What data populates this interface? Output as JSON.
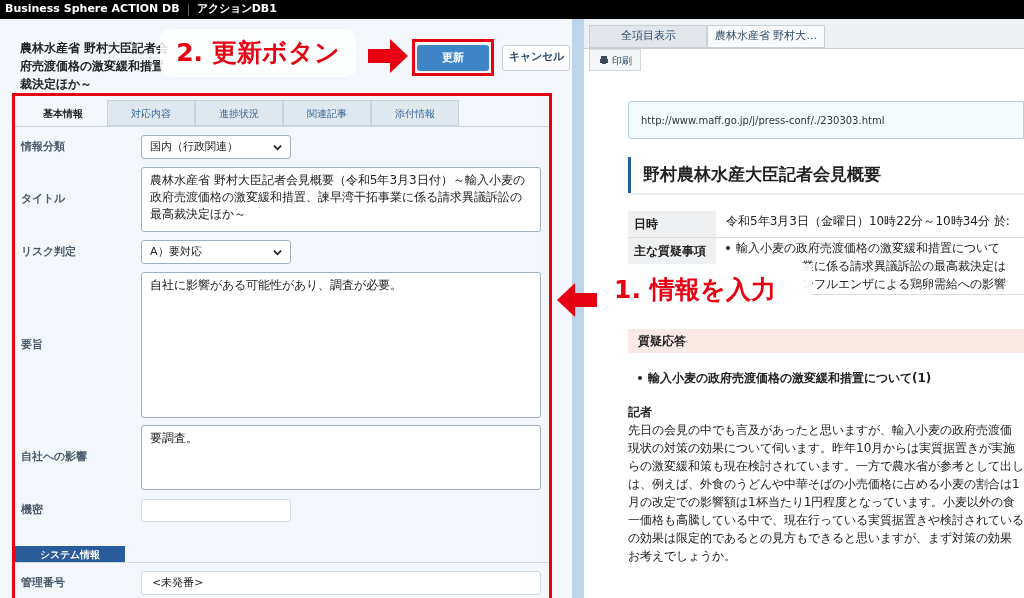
{
  "app_bar": {
    "product": "Business Sphere ACTION DB",
    "database": "アクションDB1"
  },
  "record": {
    "title_lines": [
      "農林水産省 野村大臣記者会",
      "府売渡価格の激変緩和措置",
      "裁決定ほか～"
    ],
    "buttons": [
      {
        "label": "更新",
        "kind": "primary"
      },
      {
        "label": "キャンセル",
        "kind": "secondary"
      }
    ]
  },
  "form_tabs": [
    {
      "label": "基本情報",
      "selected": true
    },
    {
      "label": "対応内容",
      "selected": false
    },
    {
      "label": "進捗状況",
      "selected": false
    },
    {
      "label": "関連記事",
      "selected": false
    },
    {
      "label": "添付情報",
      "selected": false
    }
  ],
  "fields": [
    {
      "label": "情報分類",
      "kind": "select",
      "value": "国内（行政関連）"
    },
    {
      "label": "タイトル",
      "kind": "textarea",
      "value": "農林水産省 野村大臣記者会見概要（令和5年3月3日付）～輸入小麦の政府売渡価格の激変緩和措置、諫早湾干拓事業に係る請求異議訴訟の最高裁決定ほか～"
    },
    {
      "label": "リスク判定",
      "kind": "select",
      "value": "A）要対応"
    },
    {
      "label": "要旨",
      "kind": "memo",
      "value": "自社に影響がある可能性があり、調査が必要。"
    },
    {
      "label": "自社への影響",
      "kind": "textarea",
      "value": "要調査。"
    },
    {
      "label": "機密",
      "kind": "input"
    },
    {
      "label": "システム情報",
      "kind": "section"
    },
    {
      "label": "管理番号",
      "kind": "wide",
      "value": "<未発番>"
    }
  ],
  "viewer_tabs": [
    {
      "label": "全項目表示",
      "selected": false
    },
    {
      "label": "農林水産省 野村大...",
      "selected": true
    }
  ],
  "print_button": "印刷",
  "article": {
    "url": "http://www.maff.go.jp/j/press-conf/./230303.html",
    "heading": "野村農林水産大臣記者会見概要",
    "info_table": [
      {
        "header": "日時",
        "lines": [
          "令和5年3月3日（金曜日）10時22分～10時34分 於:"
        ]
      },
      {
        "header": "主な質疑事項",
        "lines": [
          "輸入小麦の政府売渡価格の激変緩和措置について",
          "業に係る請求異議訴訟の最高裁決定は",
          "ンフルエンザによる鶏卵需給への影響"
        ]
      }
    ],
    "section": "質疑応答",
    "topic": "輸入小麦の政府売渡価格の激変緩和措置について(1)",
    "speaker": "記者",
    "paragraph_lines": [
      "先日の会見の中でも言及があったと思いますが、輸入小麦の政府売渡価",
      "現状の対策の効果について伺います。昨年10月からは実質据置きが実施",
      "らの激変緩和策も現在検討されています。一方で農水省が参考として出し",
      "は、例えば、外食のうどんや中華そばの小売価格に占める小麦の割合は1",
      "月の改定での影響額は1杯当たり1円程度となっています。小麦以外の食",
      "一価格も高騰している中で、現在行っている実質据置きや検討されている",
      "の効果は限定的であるとの見方もできると思いますが、まず対策の効果",
      "お考えでしょうか。"
    ]
  },
  "annotations": [
    {
      "text": "2. 更新ボタン"
    },
    {
      "text": "1. 情報を入力"
    }
  ]
}
